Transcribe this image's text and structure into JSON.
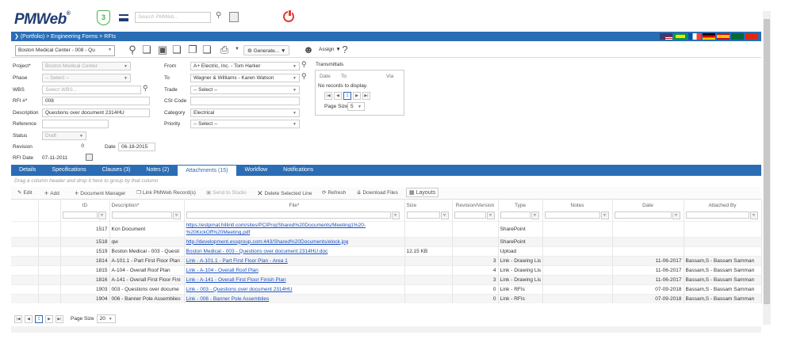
{
  "header": {
    "logo": "PMWeb",
    "logo_reg": "®",
    "notification_count": "3",
    "search_placeholder": "Search PMWeb..."
  },
  "breadcrumb": "(Portfolio) > Engineering Forms > RFIs",
  "toolbar": {
    "record_select": "Boston Medical Center - 008 - Qu",
    "generate_label": "Generate...",
    "assign_label": "Assign"
  },
  "form": {
    "project_label": "Project*",
    "project_value": "Boston Medical Center",
    "phase_label": "Phase",
    "phase_value": "-- Select --",
    "wbs_label": "WBS",
    "wbs_value": "Select WBS...",
    "rfi_label": "RFI #*",
    "rfi_value": "008",
    "description_label": "Description",
    "description_value": "Questions over document 2314HU",
    "reference_label": "Reference",
    "status_label": "Status",
    "status_value": "Draft",
    "revision_label": "Revision",
    "revision_value": "0",
    "date_label": "Date",
    "date_value": "06-18-2015",
    "rfi_date_label": "RFI Date",
    "rfi_date_value": "07-11-2011",
    "from_label": "From",
    "from_value": "A+ Electric, Inc. - Tom Harker",
    "to_label": "To",
    "to_value": "Wagner & Williams - Karen Watson",
    "trade_label": "Trade",
    "trade_value": "-- Select --",
    "csi_label": "CSI Code",
    "category_label": "Category",
    "category_value": "Electrical",
    "priority_label": "Priority",
    "priority_value": "-- Select --"
  },
  "transmittals": {
    "title": "Transmittals",
    "col_date": "Date",
    "col_to": "To",
    "col_via": "Via",
    "empty": "No records to display.",
    "page": "1",
    "page_size_label": "Page Size",
    "page_size": "5"
  },
  "tabs": [
    {
      "label": "Details"
    },
    {
      "label": "Specifications"
    },
    {
      "label": "Clauses (3)"
    },
    {
      "label": "Notes (2)"
    },
    {
      "label": "Attachments (15)"
    },
    {
      "label": "Workflow"
    },
    {
      "label": "Notifications"
    }
  ],
  "group_hint": "Drag a column header and drop it here to group by that column",
  "grid_toolbar": {
    "edit": "Edit",
    "add": "Add",
    "doc_manager": "Document Manager",
    "link_records": "Link PMWeb Record(s)",
    "send_studio": "Send to Studio",
    "delete_line": "Delete Selected Line",
    "refresh": "Refresh",
    "download": "Download Files",
    "layouts": "Layouts"
  },
  "columns": [
    "ID",
    "Description*",
    "File*",
    "Size",
    "Revision/Version",
    "Type",
    "Notes",
    "Date",
    "Attached By"
  ],
  "rows": [
    {
      "id": "1517",
      "desc": "Kcn Document",
      "file1": "https://estpmat.hillintl.com/sites/PCIProj/Shared%20Documents/Meeting1%20-",
      "file2": "%20KickOff%20Meeting.pdf",
      "size": "",
      "rev": "",
      "type": "SharePoint",
      "notes": "",
      "date": "",
      "by": ""
    },
    {
      "id": "1518",
      "desc": "qw",
      "file1": "http://development.essgroup.com:443/Shared%20Documents/elock.jpg",
      "size": "",
      "rev": "",
      "type": "SharePoint",
      "notes": "",
      "date": "",
      "by": ""
    },
    {
      "id": "1519",
      "desc": "Boston Medical - 003 - Questi",
      "file1": "Boston Medical - 003 - Questions over document 2314HU.doc",
      "size": "12.15 KB",
      "rev": "",
      "type": "Upload",
      "notes": "",
      "date": "",
      "by": ""
    },
    {
      "id": "1814",
      "desc": "A-101.1 - Part First Floor Plan",
      "file1": "Link - A-101.1 - Part First Floor Plan - Area 1",
      "size": "",
      "rev": "3",
      "type": "Link - Drawing Lis",
      "notes": "",
      "date": "11-06-2017",
      "by": "Bassam,S - Bassam Samman"
    },
    {
      "id": "1815",
      "desc": "A-104 - Overall Roof Plan",
      "file1": "Link - A-104 - Overall Roof Plan",
      "size": "",
      "rev": "4",
      "type": "Link - Drawing Lis",
      "notes": "",
      "date": "11-06-2017",
      "by": "Bassam,S - Bassam Samman"
    },
    {
      "id": "1816",
      "desc": "A-141 - Overall First Floor Fini",
      "file1": "Link - A-141 - Overall First Floor Finish Plan",
      "size": "",
      "rev": "3",
      "type": "Link - Drawing Lis",
      "notes": "",
      "date": "11-06-2017",
      "by": "Bassam,S - Bassam Samman"
    },
    {
      "id": "1903",
      "desc": "003 - Questions over docume",
      "file1": "Link - 003 - Questions over document 2314HU",
      "size": "",
      "rev": "0",
      "type": "Link - RFIs",
      "notes": "",
      "date": "07-09-2018",
      "by": "Bassam,S - Bassam Samman"
    },
    {
      "id": "1904",
      "desc": "006 - Banner Pole Assemblies",
      "file1": "Link - 006 - Banner Pole Assemblies",
      "size": "",
      "rev": "0",
      "type": "Link - RFIs",
      "notes": "",
      "date": "07-09-2018",
      "by": "Bassam,S - Bassam Samman"
    }
  ],
  "pager": {
    "page": "1",
    "page_size_label": "Page Size",
    "page_size": "20"
  },
  "colors": {
    "brand_blue": "#2a6db5",
    "logo_navy": "#1f3d73",
    "power_red": "#e53935",
    "badge_green": "#4caf50",
    "link": "#1a4fbf"
  }
}
